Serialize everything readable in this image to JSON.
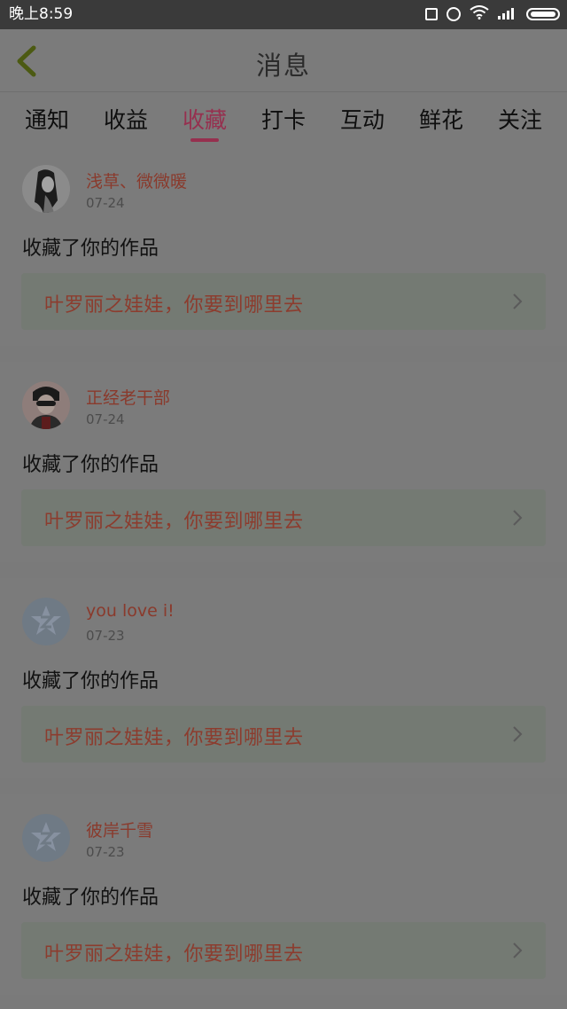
{
  "status_bar": {
    "time": "晚上8:59",
    "icons": [
      "multiwindow-icon",
      "alarm-icon",
      "wifi-icon",
      "signal-icon",
      "battery-icon"
    ]
  },
  "header": {
    "title": "消息",
    "back_icon": "chevron-left-icon"
  },
  "tabs": [
    {
      "label": "通知",
      "active": false
    },
    {
      "label": "收益",
      "active": false
    },
    {
      "label": "收藏",
      "active": true
    },
    {
      "label": "打卡",
      "active": false
    },
    {
      "label": "互动",
      "active": false
    },
    {
      "label": "鲜花",
      "active": false
    },
    {
      "label": "关注",
      "active": false
    }
  ],
  "colors": {
    "accent": "#96304f",
    "username": "#8a3a2c",
    "work_title": "#8c3c2e",
    "overlay_bg": "#7b7b7b",
    "status_bar": "#3a3a3a"
  },
  "feed": [
    {
      "username": "浅草、微微暖",
      "date": "07-24",
      "action": "收藏了你的作品",
      "work_title": "叶罗丽之娃娃，你要到哪里去",
      "avatar": "photo-avatar"
    },
    {
      "username": "正经老干部",
      "date": "07-24",
      "action": "收藏了你的作品",
      "work_title": "叶罗丽之娃娃，你要到哪里去",
      "avatar": "photo-avatar"
    },
    {
      "username": "you love i!",
      "date": "07-23",
      "action": "收藏了你的作品",
      "work_title": "叶罗丽之娃娃，你要到哪里去",
      "avatar": "default-avatar"
    },
    {
      "username": "彼岸千雪",
      "date": "07-23",
      "action": "收藏了你的作品",
      "work_title": "叶罗丽之娃娃，你要到哪里去",
      "avatar": "default-avatar"
    }
  ]
}
